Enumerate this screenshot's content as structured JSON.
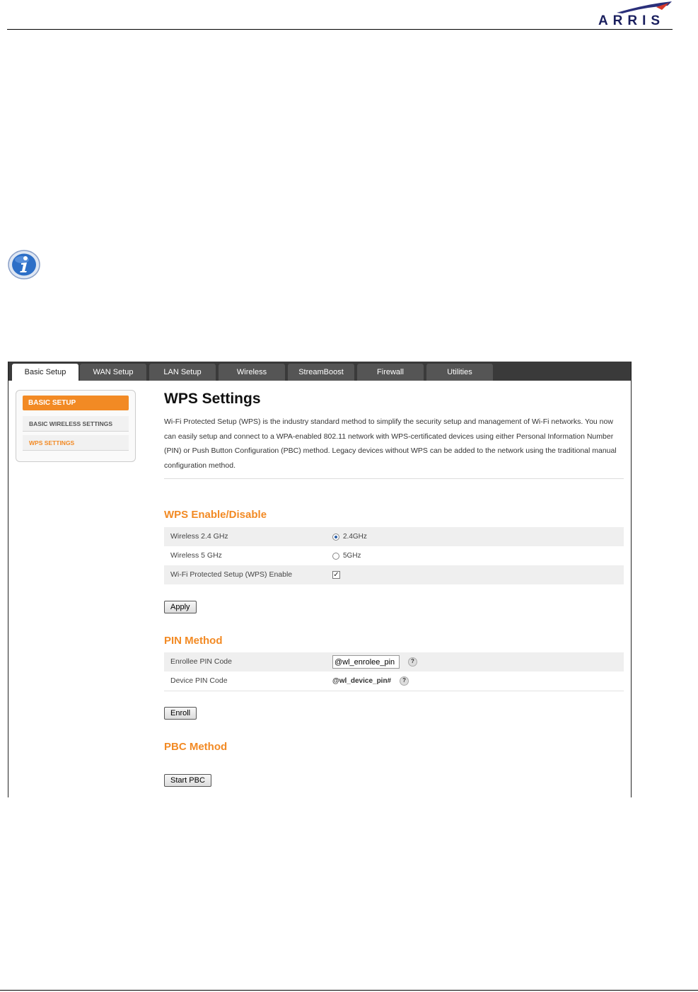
{
  "header": {
    "logo_text": "ARRIS"
  },
  "tabs": [
    {
      "label": "Basic Setup",
      "active": true
    },
    {
      "label": "WAN Setup"
    },
    {
      "label": "LAN Setup"
    },
    {
      "label": "Wireless"
    },
    {
      "label": "StreamBoost"
    },
    {
      "label": "Firewall"
    },
    {
      "label": "Utilities"
    }
  ],
  "sidebar": {
    "heading": "BASIC SETUP",
    "items": [
      {
        "label": "BASIC WIRELESS SETTINGS"
      },
      {
        "label": "WPS SETTINGS",
        "active": true
      }
    ]
  },
  "main": {
    "title": "WPS Settings",
    "intro": "Wi-Fi Protected Setup (WPS) is the industry standard method to simplify the security setup and management of Wi-Fi networks. You now can easily setup and connect to a WPA-enabled 802.11 network with WPS-certificated devices using either Personal Information Number (PIN) or Push Button Configuration (PBC) method. Legacy devices without WPS can be added to the network using the traditional manual configuration method.",
    "wps": {
      "title": "WPS Enable/Disable",
      "rows": [
        {
          "label": "Wireless 2.4 GHz",
          "option": "2.4GHz",
          "selected": true
        },
        {
          "label": "Wireless 5 GHz",
          "option": "5GHz",
          "selected": false
        },
        {
          "label": "Wi-Fi Protected Setup (WPS) Enable",
          "checked": true,
          "check_mark": "✓"
        }
      ],
      "apply_label": "Apply"
    },
    "pin": {
      "title": "PIN Method",
      "enrollee_label": "Enrollee PIN Code",
      "enrollee_value": "@wl_enrolee_pin",
      "device_label": "Device PIN Code",
      "device_value": "@wl_device_pin#",
      "help_glyph": "?",
      "enroll_label": "Enroll"
    },
    "pbc": {
      "title": "PBC Method",
      "start_label": "Start PBC"
    }
  },
  "colors": {
    "accent": "#f28a24",
    "tabbar": "#3a3a3a",
    "logo": "#1a1f5e"
  }
}
